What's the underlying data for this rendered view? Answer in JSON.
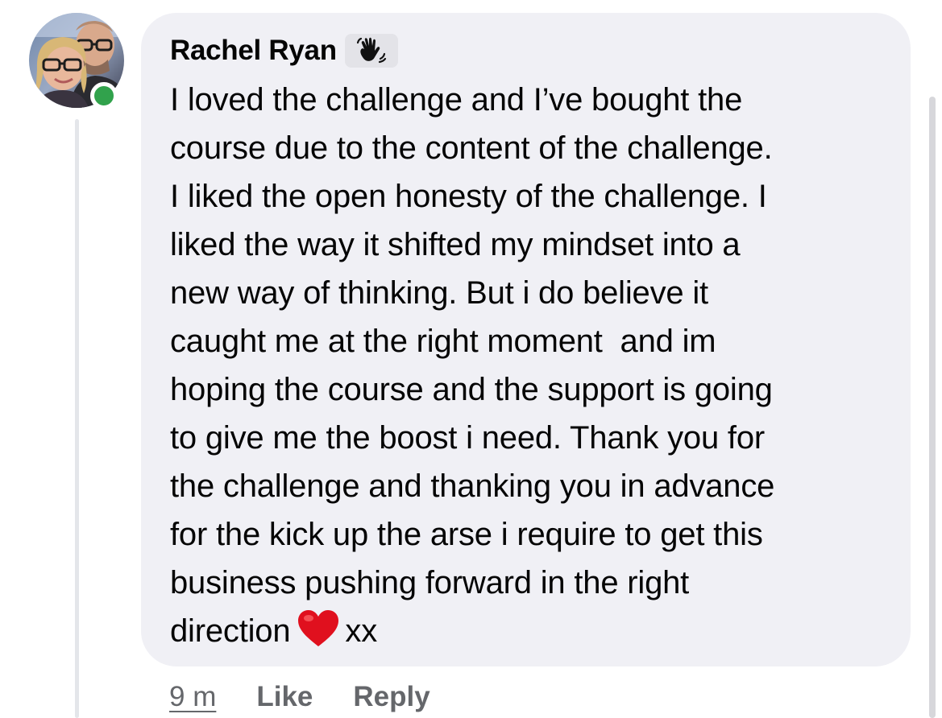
{
  "comment": {
    "author": "Rachel Ryan",
    "badge_icon": "waving-hand-icon",
    "text_lines": [
      "I loved the challenge and I’ve bought the",
      "course due to the content of the challenge.",
      "I liked the open honesty of the challenge. I",
      "liked the way it shifted my mindset into a",
      "new way of thinking. But i do believe it",
      "caught me at the right moment  and im",
      "hoping the course and the support is going",
      "to give me the boost i need. Thank you for",
      "the challenge and thanking you in advance",
      "for the kick up the arse i require to get this",
      "business pushing forward in the right"
    ],
    "last_line_before": "direction",
    "last_line_emoji": "red-heart-icon",
    "last_line_after": "xx",
    "online": true
  },
  "actions": {
    "time": "9 m",
    "like": "Like",
    "reply": "Reply"
  },
  "colors": {
    "bubble": "#f0f0f5",
    "online": "#31a24c",
    "secondary_text": "#65676b",
    "heart": "#e0101e"
  }
}
